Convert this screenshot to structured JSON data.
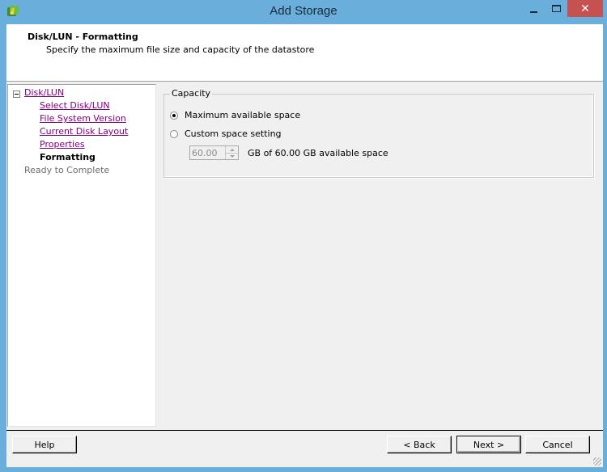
{
  "window": {
    "title": "Add Storage",
    "icon": "vsphere-client-icon",
    "controls": {
      "minimize": "minimize",
      "maximize": "maximize",
      "close": "✕"
    }
  },
  "header": {
    "title": "Disk/LUN - Formatting",
    "subtitle": "Specify the maximum file size and capacity of the datastore"
  },
  "nav": {
    "group_label": "Disk/LUN",
    "items": [
      {
        "label": "Select Disk/LUN",
        "state": "visited"
      },
      {
        "label": "File System Version",
        "state": "visited"
      },
      {
        "label": "Current Disk Layout",
        "state": "visited"
      },
      {
        "label": "Properties",
        "state": "visited"
      },
      {
        "label": "Formatting",
        "state": "current"
      }
    ],
    "after_label": "Ready to Complete"
  },
  "capacity": {
    "group_label": "Capacity",
    "options": [
      {
        "label": "Maximum available space",
        "checked": true
      },
      {
        "label": "Custom space setting",
        "checked": false
      }
    ],
    "size_value": "60.00",
    "size_label": "GB of 60.00 GB available space"
  },
  "buttons": {
    "help": "Help",
    "back": "< Back",
    "next": "Next >",
    "cancel": "Cancel"
  }
}
